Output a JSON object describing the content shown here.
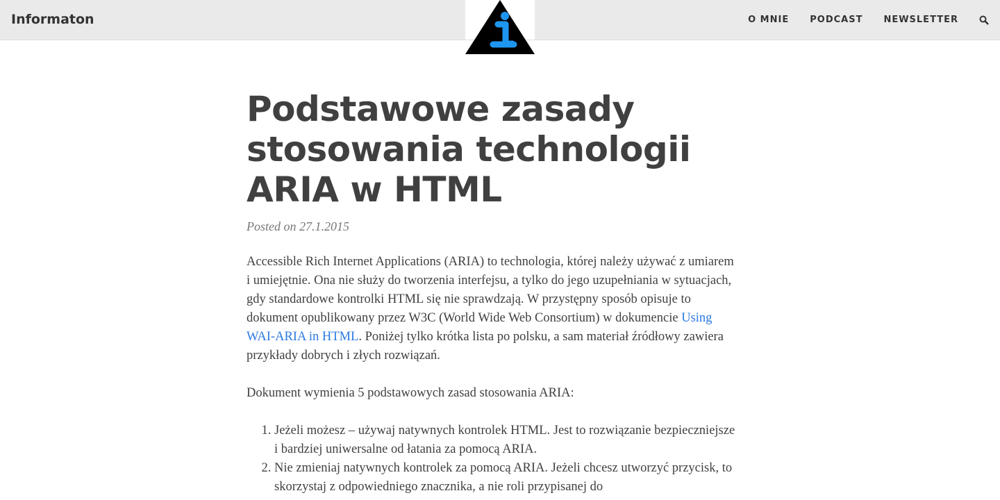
{
  "header": {
    "brand": "Informaton",
    "nav": [
      "O MNIE",
      "PODCAST",
      "NEWSLETTER"
    ],
    "search_icon": "search-icon",
    "logo_colors": {
      "triangle": "#000000",
      "glyph": "#1e96f0"
    }
  },
  "post": {
    "title": "Podstawowe zasady stosowania technologii ARIA w HTML",
    "meta": "Posted on 27.1.2015",
    "p1_before": "Accessible Rich Internet Applications (ARIA) to technologia, której należy używać z umiarem i umiejętnie. Ona nie służy do tworzenia interfejsu, a tylko do jego uzupełniania w sytuacjach, gdy standardowe kontrolki HTML się nie sprawdzają. W przystępny sposób opisuje to dokument opublikowany przez W3C (World Wide Web Consortium) w dokumencie ",
    "p1_link": "Using WAI-ARIA in HTML",
    "p1_after": ". Poniżej tylko krótka lista po polsku, a sam materiał źródłowy zawiera przykłady dobrych i złych rozwiązań.",
    "p2": "Dokument wymienia 5 podstawowych zasad stosowania ARIA:",
    "list": [
      "Jeżeli możesz – używaj natywnych kontrolek HTML. Jest to rozwiązanie bezpieczniejsze i bardziej uniwersalne od łatania za pomocą ARIA.",
      "Nie zmieniaj natywnych kontrolek za pomocą ARIA. Jeżeli chcesz utworzyć przycisk, to skorzystaj z odpowiedniego znacznika, a nie roli przypisanej do"
    ]
  }
}
